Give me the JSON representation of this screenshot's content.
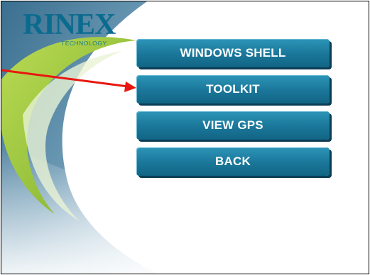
{
  "logo": {
    "brand": "RINEX",
    "tagline": "TECHNOLOGY"
  },
  "menu": {
    "windows_shell": "WINDOWS SHELL",
    "toolkit": "TOOLKIT",
    "view_gps": "VIEW GPS",
    "back": "BACK"
  },
  "annotation": {
    "arrow_color": "#e8170f",
    "target": "toolkit-button"
  },
  "colors": {
    "button": "#1a7699",
    "brand_blue": "#0b6b8e",
    "accent_green": "#9cc83a"
  }
}
